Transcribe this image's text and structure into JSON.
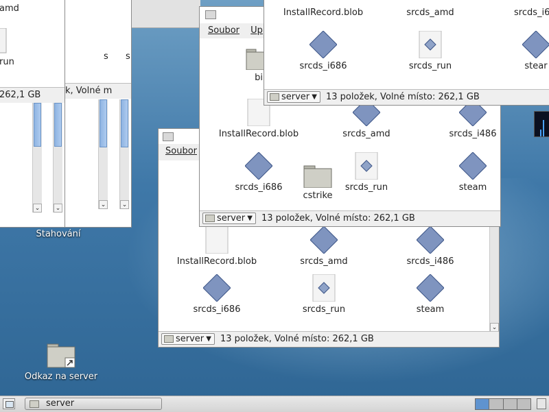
{
  "desktop": {
    "icon_stahovani": "Stahování",
    "icon_link": "Odkaz na server"
  },
  "menu": {
    "soubor": "Soubor",
    "upravit_fragment": "Up"
  },
  "status": {
    "location": "server",
    "summary": "13 položek, Volné místo: 262,1 GB",
    "partial_right": "262,1 GB",
    "partial_mid": "k, Volné m"
  },
  "files": {
    "install": "InstallRecord.blob",
    "srcds_amd": "srcds_amd",
    "srcds_i486": "srcds_i486",
    "srcds_i686": "srcds_i686",
    "srcds_run": "srcds_run",
    "steam": "steam",
    "cstrike": "cstrike",
    "bin_fragment": "bi",
    "run_fragment": "run",
    "amd_fragment": "amd",
    "steam_fragment": "stear",
    "i6_fragment": "srcds_i6",
    "s_fragment": "s"
  },
  "taskbar": {
    "task_label": "server"
  },
  "colors": {
    "selection_blue": "#5f93cf",
    "folder": "#cfcfc6",
    "desktop": "#3f78a8"
  }
}
